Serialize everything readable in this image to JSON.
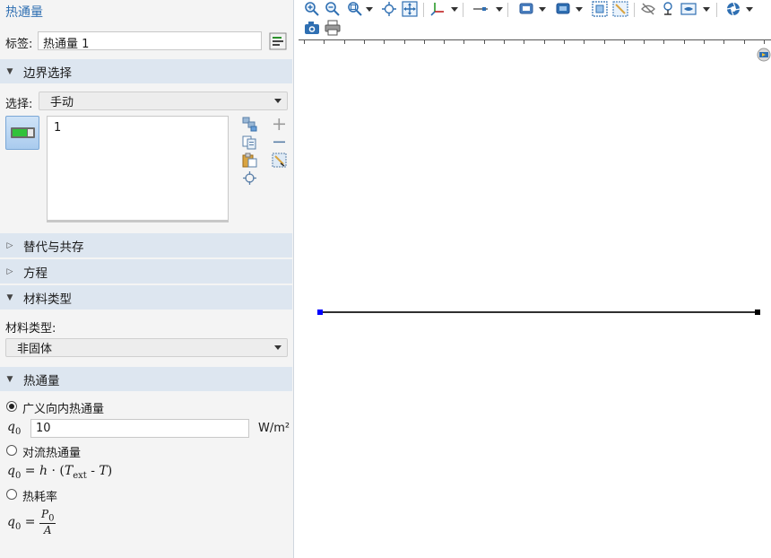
{
  "settings": {
    "title": "热通量",
    "label_caption": "标签:",
    "label_value": "热通量 1",
    "boundary_section": "边界选择",
    "selection_caption": "选择:",
    "selection_value": "手动",
    "boundary_list": [
      "1"
    ],
    "override_section": "替代与共存",
    "equation_section": "方程",
    "material_section": "材料类型",
    "material_caption": "材料类型:",
    "material_value": "非固体",
    "heatflux_section": "热通量",
    "options": {
      "general_inward": "广义向内热通量",
      "convective": "对流热通量",
      "heat_rate": "热耗率"
    },
    "selected_option": "general_inward",
    "q0_symbol": "q",
    "q0_sub": "0",
    "q0_value": "10",
    "q0_unit": "W/m²",
    "convective_eq": {
      "lhs": "q",
      "lhs_sub": "0",
      "equals": "=",
      "h": "h",
      "dot": "·",
      "open": "(",
      "T_ext": "T",
      "T_ext_sub": "ext",
      "minus": "-",
      "T": "T",
      "close": ")"
    },
    "heat_rate_eq": {
      "lhs": "q",
      "lhs_sub": "0",
      "equals": "=",
      "num": "P",
      "num_sub": "0",
      "den": "A"
    }
  },
  "graphics": {
    "toolbar_row1": [
      "zoom-in-icon",
      "zoom-out-icon",
      "zoom-box-icon",
      "center-icon",
      "zoom-extents-icon",
      "axes-icon",
      "line-style-icon",
      "select-icon",
      "render-icon",
      "select-box-icon",
      "clear-select-icon",
      "hide-icon",
      "transparency-icon",
      "view-icon",
      "light-icon"
    ],
    "toolbar_row2": [
      "camera-icon",
      "print-icon"
    ],
    "accent_point": "#0000ff",
    "end_point": "#000000"
  }
}
